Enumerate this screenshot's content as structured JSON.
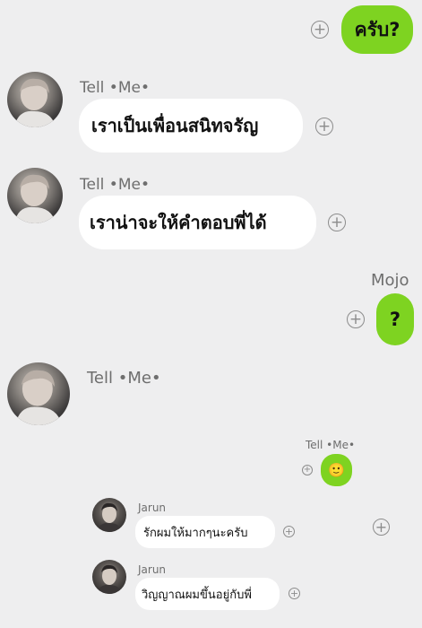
{
  "messages": [
    {
      "sender": "",
      "text": "ครับ?"
    },
    {
      "sender": "Tell •Me•",
      "text": "เราเป็นเพื่อนสนิทจรัญ"
    },
    {
      "sender": "Tell •Me•",
      "text": "เราน่าจะให้คำตอบพี่ได้"
    },
    {
      "sender": "Mojo",
      "text": "?"
    },
    {
      "sender": "Tell •Me•",
      "text": ""
    },
    {
      "sender": "Tell •Me•",
      "sticker": "smiling-face"
    },
    {
      "sender": "Jarun",
      "text": "รักผมให้มากๆนะครับ"
    },
    {
      "sender": "Jarun",
      "text": "วิญญาณผมขึ้นอยู่กับพี่"
    }
  ],
  "action_symbol": "+",
  "emoji": "🙂",
  "colors": {
    "background": "#eeeeef",
    "outgoing_bubble": "#7ed321",
    "incoming_bubble": "#ffffff",
    "name_text": "#6e6e6e"
  }
}
